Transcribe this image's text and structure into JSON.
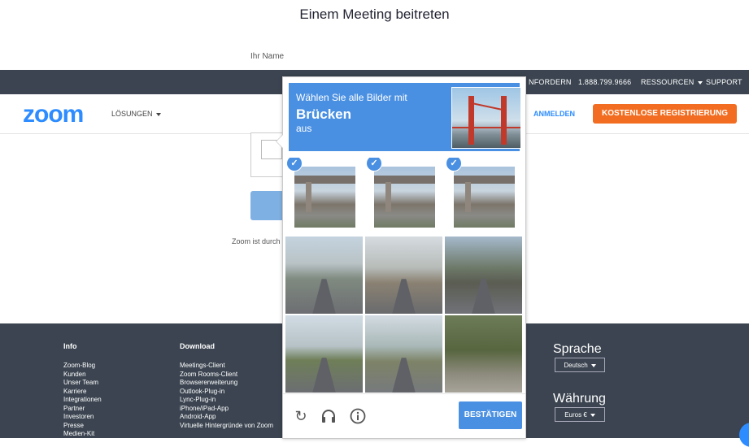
{
  "page": {
    "title": "Einem Meeting beitreten",
    "name_label": "Ihr Name",
    "partial_text": "Zoom ist durch"
  },
  "topbar": {
    "request_demo": "NFORDERN",
    "phone": "1.888.799.9666",
    "resources": "RESSOURCEN",
    "support": "SUPPORT"
  },
  "nav": {
    "logo": "zoom",
    "solutions": "LÖSUNGEN",
    "signin": "ANMELDEN",
    "signup": "KOSTENLOSE REGISTRIERUNG"
  },
  "footer": {
    "info": {
      "heading": "Info",
      "items": [
        "Zoom-Blog",
        "Kunden",
        "Unser Team",
        "Karriere",
        "Integrationen",
        "Partner",
        "Investoren",
        "Presse",
        "Medien-Kit"
      ]
    },
    "download": {
      "heading": "Download",
      "items": [
        "Meetings-Client",
        "Zoom Rooms-Client",
        "Browsererweiterung",
        "Outlook-Plug-in",
        "Lync-Plug-in",
        "iPhone/iPad-App",
        "Android-App",
        "Virtuelle Hintergründe von Zoom"
      ]
    },
    "language": {
      "heading": "Sprache",
      "value": "Deutsch"
    },
    "currency": {
      "heading": "Währung",
      "value": "Euros €"
    }
  },
  "captcha": {
    "line1": "Wählen Sie alle Bilder mit",
    "target_word": "Brücken",
    "line3": "aus",
    "example_image": "golden-gate-bridge",
    "selected_tiles": [
      0,
      1,
      2
    ],
    "tiles": [
      "bridge",
      "bridge",
      "bridge",
      "street",
      "street",
      "street",
      "street",
      "street",
      "street"
    ],
    "icons": [
      "reload-icon",
      "headphones-icon",
      "info-icon"
    ],
    "confirm_label": "BESTÄTIGEN",
    "accent_color": "#4a90e2"
  },
  "colors": {
    "zoom_blue": "#2d8cff",
    "signup_orange": "#f26d21",
    "dark_bar": "#3b4450"
  }
}
